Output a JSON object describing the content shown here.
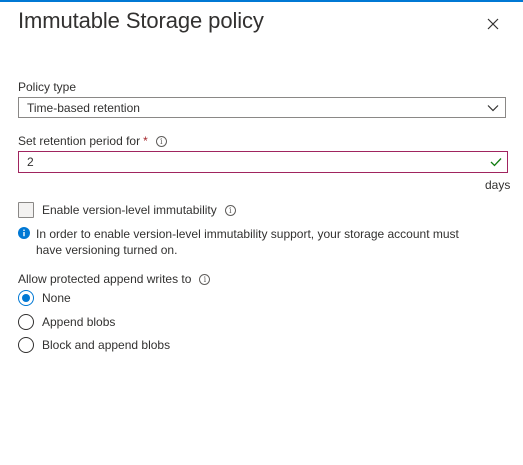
{
  "panel": {
    "title": "Immutable Storage policy",
    "close_icon": "close-icon",
    "accent": "#0078d4"
  },
  "policy_type": {
    "label": "Policy type",
    "selected": "Time-based retention",
    "icon": "chevron-down-icon"
  },
  "retention": {
    "label": "Set retention period for",
    "required_marker": "*",
    "value": "2",
    "units": "days",
    "valid_icon": "checkmark-icon",
    "border_color": "#a0245f"
  },
  "version_immutability": {
    "label": "Enable version-level immutability",
    "checked": false,
    "notice": "In order to enable version-level immutability support, your storage account must have versioning turned on.",
    "notice_icon": "info-icon"
  },
  "append_writes": {
    "label": "Allow protected append writes to",
    "options": [
      {
        "label": "None",
        "selected": true
      },
      {
        "label": "Append blobs",
        "selected": false
      },
      {
        "label": "Block and append blobs",
        "selected": false
      }
    ]
  }
}
